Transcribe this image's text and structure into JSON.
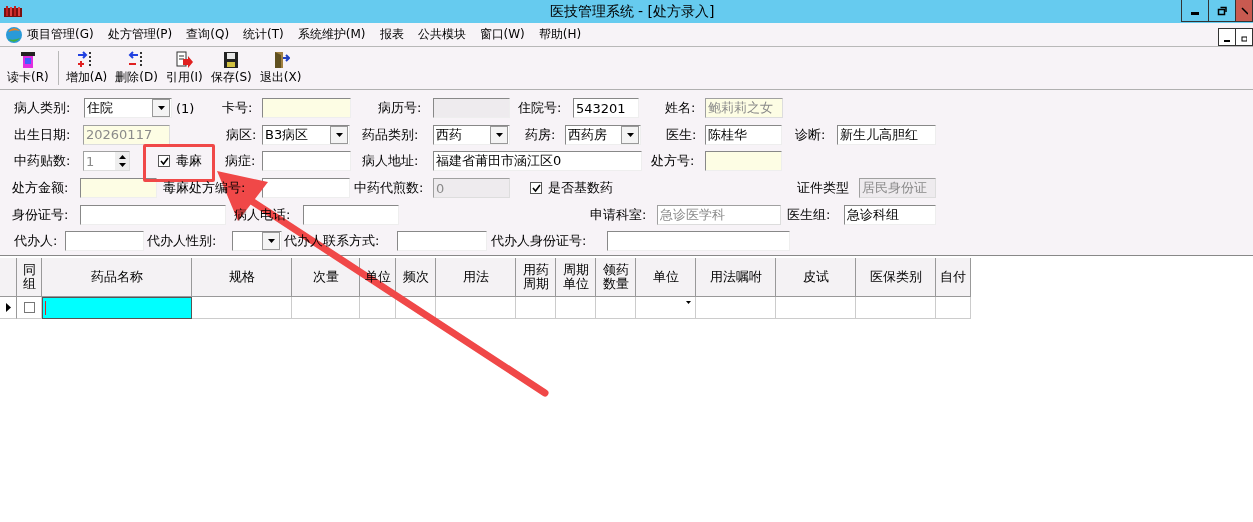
{
  "window": {
    "title": "医技管理系统 - [处方录入]"
  },
  "menu": [
    "项目管理(G)",
    "处方管理(P)",
    "查询(Q)",
    "统计(T)",
    "系统维护(M)",
    "报表",
    "公共模块",
    "窗口(W)",
    "帮助(H)"
  ],
  "toolbar": [
    "读卡(R)",
    "增加(A)",
    "删除(D)",
    "引用(I)",
    "保存(S)",
    "退出(X)"
  ],
  "form": [
    [
      {
        "kind": "combo",
        "label": "病人类别:",
        "value": "住院",
        "highlighted": false,
        "readonly": false,
        "disabled": false
      },
      {
        "kind": "text",
        "label": "(1)"
      },
      {
        "kind": "field",
        "label": "卡号:",
        "highlighted": true,
        "readonly": false,
        "disabled": false
      },
      {
        "kind": "field",
        "label": "病历号:",
        "highlighted": false,
        "readonly": false,
        "disabled": true
      },
      {
        "kind": "field",
        "label": "住院号:",
        "value": "543201",
        "highlighted": false,
        "readonly": false,
        "disabled": false
      },
      {
        "kind": "field",
        "label": "姓名:",
        "value": "鲍莉莉之女",
        "highlighted": true,
        "readonly": true,
        "disabled": false
      }
    ],
    [
      {
        "kind": "field",
        "label": "出生日期:",
        "value": "20260117",
        "highlighted": true,
        "readonly": true,
        "disabled": false
      },
      {
        "kind": "combo",
        "label": "病区:",
        "value": "B3病区",
        "highlighted": false,
        "readonly": false,
        "disabled": false
      },
      {
        "kind": "combo",
        "label": "药品类别:",
        "value": "西药",
        "highlighted": false,
        "readonly": false,
        "disabled": false
      },
      {
        "kind": "combo",
        "label": "药房:",
        "value": "西药房",
        "highlighted": false,
        "readonly": false,
        "disabled": false
      },
      {
        "kind": "field",
        "label": "医生:",
        "value": "陈桂华",
        "highlighted": false,
        "readonly": false,
        "disabled": false
      },
      {
        "kind": "field",
        "label": "诊断:",
        "value": "新生儿高胆红",
        "highlighted": false,
        "readonly": false,
        "disabled": false
      }
    ],
    [
      {
        "kind": "spin",
        "label": "中药贴数:",
        "value": "1",
        "highlighted": false,
        "readonly": true,
        "disabled": false
      },
      {
        "kind": "check",
        "label": "毒麻",
        "checked": true
      },
      {
        "kind": "field",
        "label": "病症:",
        "highlighted": false,
        "readonly": false,
        "disabled": false
      },
      {
        "kind": "field",
        "label": "病人地址:",
        "value": "福建省莆田市涵江区0",
        "highlighted": false,
        "readonly": false,
        "disabled": false
      },
      {
        "kind": "field",
        "label": "处方号:",
        "highlighted": true,
        "readonly": false,
        "disabled": false
      }
    ],
    [
      {
        "kind": "field",
        "label": "处方金额:",
        "highlighted": true,
        "readonly": false,
        "disabled": false
      },
      {
        "kind": "field",
        "label": "毒麻处方编号:",
        "highlighted": false,
        "readonly": false,
        "disabled": false
      },
      {
        "kind": "field",
        "label": "中药代煎数:",
        "value": "0",
        "highlighted": false,
        "readonly": true,
        "disabled": true
      },
      {
        "kind": "check",
        "label": "是否基数药",
        "checked": true
      },
      {
        "kind": "field",
        "label": "证件类型",
        "value": "居民身份证",
        "highlighted": false,
        "readonly": true,
        "disabled": true
      }
    ],
    [
      {
        "kind": "field",
        "label": "身份证号:",
        "highlighted": false,
        "readonly": false,
        "disabled": false
      },
      {
        "kind": "field",
        "label": "病人电话:",
        "highlighted": false,
        "readonly": false,
        "disabled": false
      },
      {
        "kind": "field",
        "label": "申请科室:",
        "value": "急诊医学科",
        "highlighted": false,
        "readonly": true,
        "disabled": false
      },
      {
        "kind": "field",
        "label": "医生组:",
        "value": "急诊科组",
        "highlighted": false,
        "readonly": false,
        "disabled": false
      }
    ],
    [
      {
        "kind": "field",
        "label": "代办人:",
        "highlighted": false,
        "readonly": false,
        "disabled": false
      },
      {
        "kind": "combo",
        "label": "代办人性别:",
        "highlighted": false,
        "readonly": false,
        "disabled": false
      },
      {
        "kind": "field",
        "label": "代办人联系方式:",
        "highlighted": false,
        "readonly": false,
        "disabled": false
      },
      {
        "kind": "field",
        "label": "代办人身份证号:",
        "highlighted": false,
        "readonly": false,
        "disabled": false
      }
    ]
  ],
  "grid": {
    "columns": [
      "同组",
      "药品名称",
      "规格",
      "次量",
      "单位",
      "频次",
      "用法",
      "用药周期",
      "周期单位",
      "领药数量",
      "单位",
      "用法嘱咐",
      "皮试",
      "医保类别",
      "自付"
    ],
    "rows": [
      {
        "current": true,
        "checked": false,
        "cells": [
          {
            "kind": "text",
            "selected": true
          },
          {
            "kind": "text",
            "selected": false
          },
          {
            "kind": "text",
            "selected": false
          },
          {
            "kind": "text",
            "selected": false
          },
          {
            "kind": "text",
            "selected": false
          },
          {
            "kind": "text",
            "selected": false
          },
          {
            "kind": "text",
            "selected": false
          },
          {
            "kind": "text",
            "selected": false
          },
          {
            "kind": "text",
            "selected": false
          },
          {
            "kind": "combo",
            "selected": false
          },
          {
            "kind": "text",
            "selected": false
          },
          {
            "kind": "text",
            "selected": false
          },
          {
            "kind": "text",
            "selected": false
          },
          {
            "kind": "text",
            "selected": false
          }
        ]
      }
    ]
  }
}
